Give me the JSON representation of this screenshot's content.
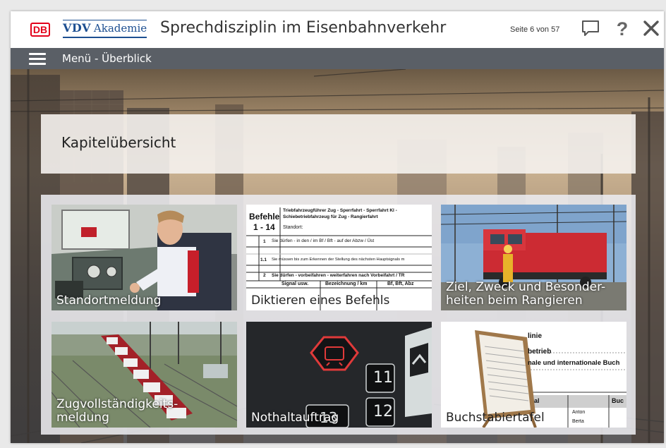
{
  "header": {
    "db_logo": "DB",
    "vdv_logo": "VDV",
    "akademie_logo": "Akademie",
    "title": "Sprechdisziplin im Eisenbahnverkehr",
    "page_indicator": "Seite 6 von 57",
    "icons": [
      "comment-icon",
      "help-icon",
      "close-icon"
    ],
    "help_glyph": "?"
  },
  "menubar": {
    "label": "Menü - Überblick",
    "icon": "hamburger-icon"
  },
  "main": {
    "section_title": "Kapitelübersicht",
    "tiles": [
      {
        "label": "Standortmeldung"
      },
      {
        "label": "Diktieren eines Befehls"
      },
      {
        "label_line1": "Ziel, Zweck und Besonder-",
        "label_line2": "heiten beim Rangieren"
      },
      {
        "label_line1": "Zugvollständigkeits-",
        "label_line2": "meldung"
      },
      {
        "label": "Nothaltauftrag"
      },
      {
        "label": "Buchstabiertafel"
      }
    ]
  },
  "tile_images": {
    "befehl_doc": {
      "title": "Befehle",
      "range": "1 - 14",
      "head1": "Triebfahrzeugführer Zug - Sperrfahrt - Sperrfahrt Kl -",
      "head2": "Schiebetriebfahrzeug für Zug - Rangierfahrt",
      "standort": "Standort:",
      "row1_num": "1",
      "row1_text": "Sie dürfen - in den / im Bf / Bft - auf der Abzw / Üst",
      "row11_num": "1.1",
      "row11_text": "Sie müssen bis zum Erkennen der Stellung des nächsten Hauptsignals m",
      "row2_num": "2",
      "row2_text": "Sie dürfen - vorbeifahren - weiterfahren nach Vorbeifahrt / TR",
      "col1": "Signal usw.",
      "col2": "Bezeichnung / km",
      "col3": "Bf, Bft, Abz"
    },
    "buchstabier_doc": {
      "line1": "linie",
      "line2": "betrieb",
      "line3": "nale und internationale Buch",
      "col_a": "al",
      "col_b": "Buc",
      "name1": "Anton",
      "name2": "Berta"
    },
    "nothalt_keys": [
      "11",
      "12",
      "13"
    ]
  },
  "colors": {
    "db_red": "#e2001a",
    "vdv_blue": "#1d4f91",
    "menubar": "#5a5f66"
  }
}
